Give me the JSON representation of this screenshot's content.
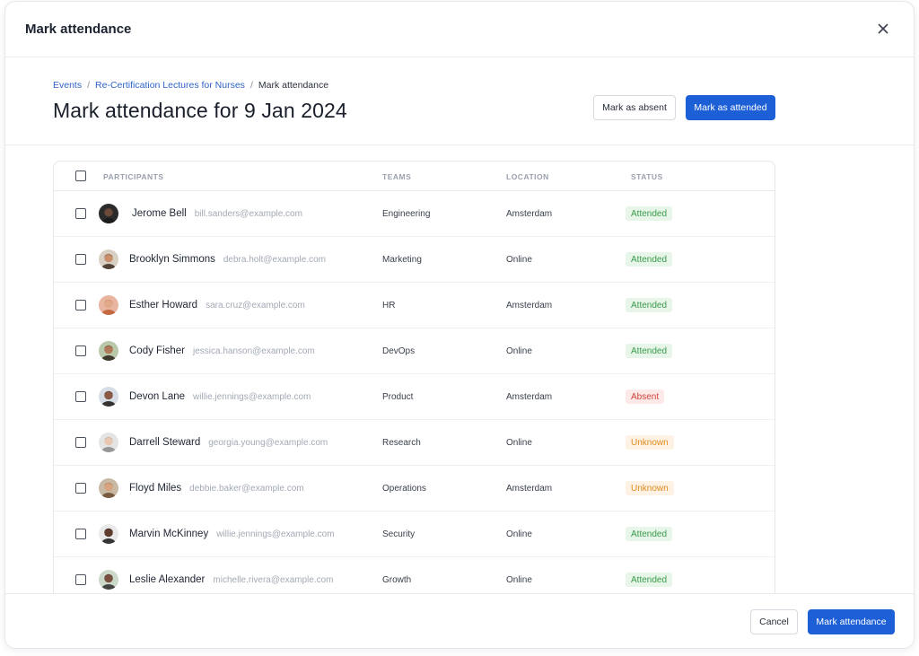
{
  "modal": {
    "title": "Mark attendance"
  },
  "breadcrumb": {
    "items": [
      "Events",
      "Re-Certification Lectures for Nurses",
      "Mark attendance"
    ],
    "separator": "/"
  },
  "page": {
    "title": "Mark attendance for 9 Jan 2024"
  },
  "actions": {
    "mark_absent": "Mark as absent",
    "mark_attended": "Mark as attended"
  },
  "table": {
    "headers": {
      "participants": "PARTICIPANTS",
      "teams": "TEAMS",
      "location": "LOCATION",
      "status": "STATUS"
    },
    "rows": [
      {
        "name": "Jerome Bell",
        "email": "bill.sanders@example.com",
        "team": "Engineering",
        "location": "Amsterdam",
        "status": "Attended"
      },
      {
        "name": "Brooklyn Simmons",
        "email": "debra.holt@example.com",
        "team": "Marketing",
        "location": "Online",
        "status": "Attended"
      },
      {
        "name": "Esther Howard",
        "email": "sara.cruz@example.com",
        "team": "HR",
        "location": "Amsterdam",
        "status": "Attended"
      },
      {
        "name": "Cody Fisher",
        "email": "jessica.hanson@example.com",
        "team": "DevOps",
        "location": "Online",
        "status": "Attended"
      },
      {
        "name": "Devon Lane",
        "email": "willie.jennings@example.com",
        "team": "Product",
        "location": "Amsterdam",
        "status": "Absent"
      },
      {
        "name": "Darrell Steward",
        "email": "georgia.young@example.com",
        "team": "Research",
        "location": "Online",
        "status": "Unknown"
      },
      {
        "name": "Floyd Miles",
        "email": "debbie.baker@example.com",
        "team": "Operations",
        "location": "Amsterdam",
        "status": "Unknown"
      },
      {
        "name": "Marvin McKinney",
        "email": "willie.jennings@example.com",
        "team": "Security",
        "location": "Online",
        "status": "Attended"
      },
      {
        "name": "Leslie Alexander",
        "email": "michelle.rivera@example.com",
        "team": "Growth",
        "location": "Online",
        "status": "Attended"
      }
    ]
  },
  "footer": {
    "cancel": "Cancel",
    "submit": "Mark attendance"
  },
  "colors": {
    "primary": "#1d5fd6",
    "attended_bg": "#e7f6e9",
    "attended_fg": "#3a9a4a",
    "absent_bg": "#fde9e8",
    "absent_fg": "#d0433a",
    "unknown_bg": "#fdf2e3",
    "unknown_fg": "#e08a1e"
  },
  "icons": {
    "close": "close-icon",
    "avatar": "avatar"
  }
}
